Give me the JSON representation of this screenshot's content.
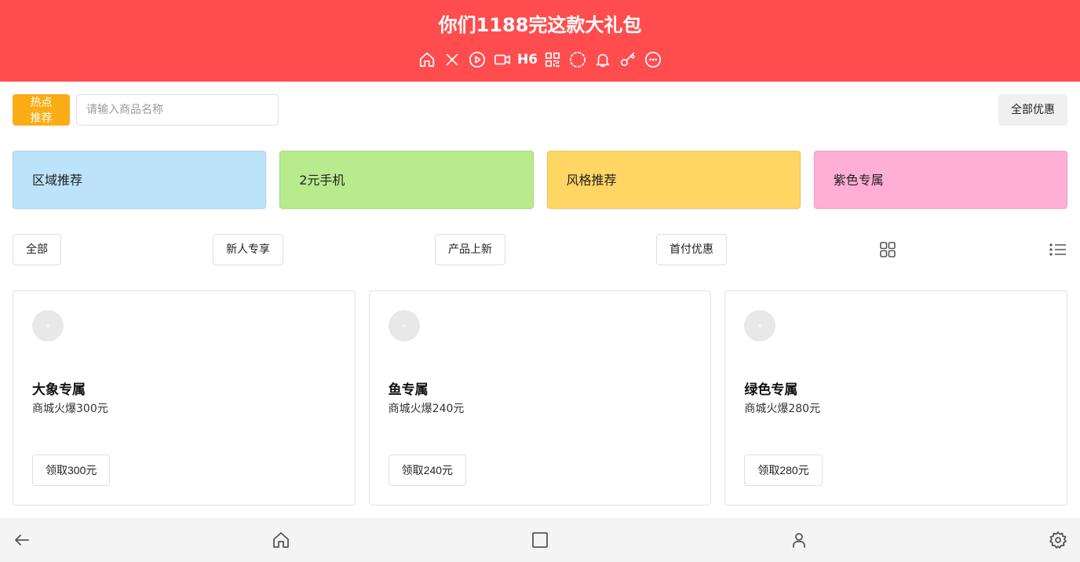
{
  "header": {
    "title": "你们1188完这款大礼包",
    "icons": [
      "home-icon",
      "close-icon",
      "play-icon",
      "video-icon",
      "h6-icon",
      "qrcode-icon",
      "dashed-circle-icon",
      "bell-icon",
      "key-icon",
      "more-icon"
    ],
    "h6_label": "H6",
    "background": "#ff4d4f"
  },
  "toolbar": {
    "hot_label_line1": "热点",
    "hot_label_line2": "推荐",
    "search_placeholder": "请输入商品名称",
    "all_offers_label": "全部优惠",
    "hot_color": "#faad14"
  },
  "categories": [
    {
      "label": "区域推荐",
      "color": "#bde3fb"
    },
    {
      "label": "2元手机",
      "color": "#b8eb8d"
    },
    {
      "label": "风格推荐",
      "color": "#ffd564"
    },
    {
      "label": "紫色专属",
      "color": "#ffafd6"
    }
  ],
  "filters": [
    {
      "label": "全部"
    },
    {
      "label": "新人专享"
    },
    {
      "label": "产品上新"
    },
    {
      "label": "首付优惠"
    }
  ],
  "view_icons": [
    "grid-view-icon",
    "list-view-icon"
  ],
  "cards": [
    {
      "title": "大象专属",
      "subtitle": "商城火爆300元",
      "button": "领取300元"
    },
    {
      "title": "鱼专属",
      "subtitle": "商城火爆240元",
      "button": "领取240元"
    },
    {
      "title": "绿色专属",
      "subtitle": "商城火爆280元",
      "button": "领取280元"
    }
  ],
  "bottom_nav": [
    "back-arrow-icon",
    "home-icon",
    "square-icon",
    "user-icon",
    "settings-icon"
  ]
}
